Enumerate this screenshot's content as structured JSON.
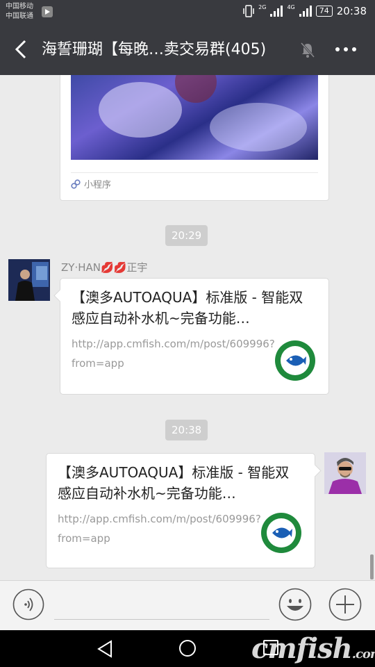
{
  "status": {
    "carrier1": "中国移动",
    "carrier2": "中国联通",
    "net1": "2G",
    "net2": "4G",
    "battery": "74",
    "time": "20:38"
  },
  "header": {
    "title": "海誓珊瑚【每晚…卖交易群(405)"
  },
  "messages": {
    "mini_program_label": "小程序",
    "time1": "20:29",
    "time2": "20:38",
    "sender_name": "ZY·HAN💋💋正宇",
    "link1": {
      "title": "【澳多AUTOAQUA】标准版 - 智能双感应自动补水机~完备功能…",
      "url": "http://app.cmfish.com/m/post/609996?from=app"
    },
    "link2": {
      "title": "【澳多AUTOAQUA】标准版 - 智能双感应自动补水机~完备功能…",
      "url": "http://app.cmfish.com/m/post/609996?from=app"
    }
  },
  "watermark": {
    "text": "cmfish",
    "suffix": ".com"
  },
  "colors": {
    "titlebar": "#393a3f",
    "chat_bg": "#ebebeb",
    "time_pill": "#cecece"
  }
}
